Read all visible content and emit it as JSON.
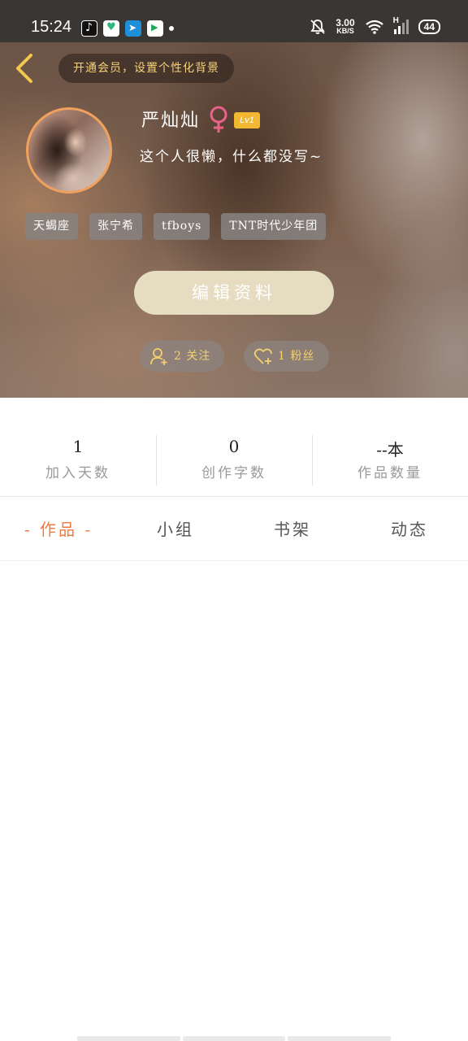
{
  "status_bar": {
    "time": "15:24",
    "net_speed_value": "3.00",
    "net_speed_unit": "KB/S",
    "signal_type": "H",
    "battery": "44"
  },
  "header": {
    "vip_banner": "开通会员，设置个性化背景",
    "nickname": "严灿灿",
    "level": "Lv1",
    "bio": "这个人很懒，什么都没写~",
    "tags": [
      "天蝎座",
      "张宁希",
      "tfboys",
      "TNT时代少年团"
    ],
    "edit_label": "编辑资料",
    "follow_text": "2 关注",
    "fans_text": "1 粉丝"
  },
  "stats": [
    {
      "value": "1",
      "label": "加入天数"
    },
    {
      "value": "0",
      "label": "创作字数"
    },
    {
      "value": "--本",
      "label": "作品数量"
    }
  ],
  "tabs": [
    {
      "label": "- 作品 -",
      "active": true
    },
    {
      "label": "小组",
      "active": false
    },
    {
      "label": "书架",
      "active": false
    },
    {
      "label": "动态",
      "active": false
    }
  ],
  "colors": {
    "accent": "#f17a3c",
    "gold": "#f5cf6f",
    "level_badge": "#f2b832",
    "gender": "#e8628a"
  },
  "icons": [
    "back-arrow-icon",
    "female-gender-icon",
    "person-plus-icon",
    "heart-plus-icon",
    "bell-off-icon",
    "wifi-icon",
    "signal-icon",
    "battery-icon"
  ]
}
